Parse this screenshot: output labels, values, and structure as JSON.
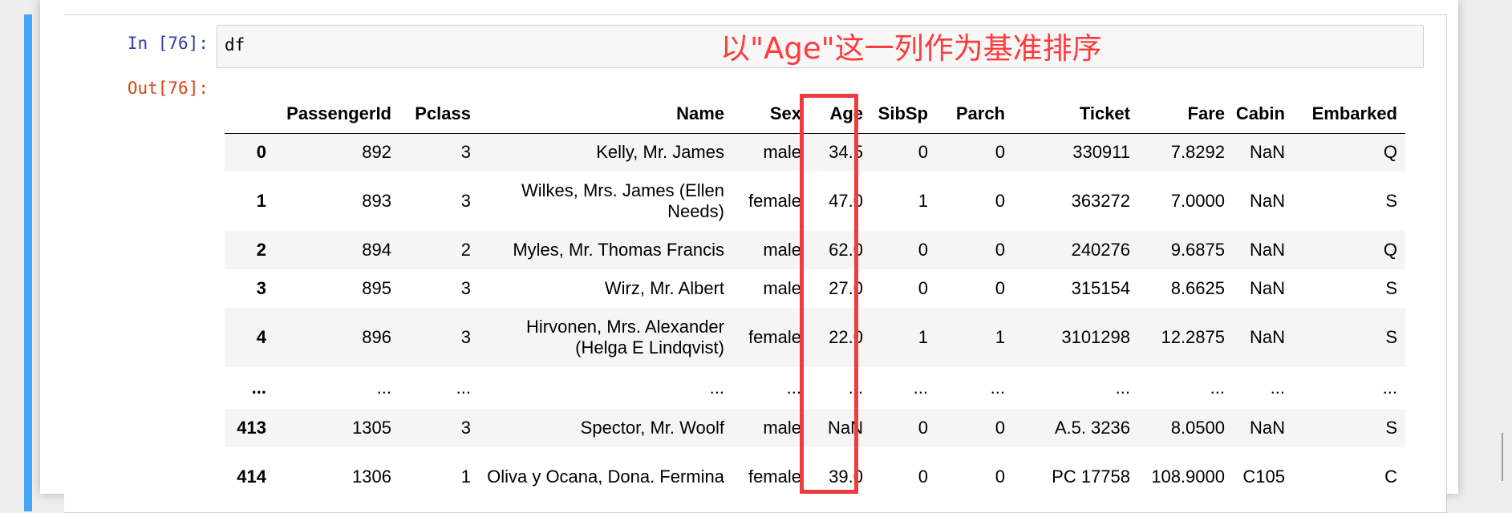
{
  "notebook": {
    "input_prompt": "In  [76]:",
    "input_code": "df",
    "output_prompt": "Out[76]:",
    "annotation": "以\"Age\"这一列作为基准排序"
  },
  "colors": {
    "cell_bar": "#42a5f5",
    "highlight": "#ee3b3b",
    "annotation": "#ff3b3b"
  },
  "table": {
    "columns": [
      "",
      "PassengerId",
      "Pclass",
      "Name",
      "Sex",
      "Age",
      "SibSp",
      "Parch",
      "Ticket",
      "Fare",
      "Cabin",
      "Embarked"
    ],
    "rows": [
      {
        "cells": [
          "0",
          "892",
          "3",
          "Kelly, Mr. James",
          "male",
          "34.5",
          "0",
          "0",
          "330911",
          "7.8292",
          "NaN",
          "Q"
        ]
      },
      {
        "cells": [
          "1",
          "893",
          "3",
          "Wilkes, Mrs. James (Ellen Needs)",
          "female",
          "47.0",
          "1",
          "0",
          "363272",
          "7.0000",
          "NaN",
          "S"
        ]
      },
      {
        "cells": [
          "2",
          "894",
          "2",
          "Myles, Mr. Thomas Francis",
          "male",
          "62.0",
          "0",
          "0",
          "240276",
          "9.6875",
          "NaN",
          "Q"
        ]
      },
      {
        "cells": [
          "3",
          "895",
          "3",
          "Wirz, Mr. Albert",
          "male",
          "27.0",
          "0",
          "0",
          "315154",
          "8.6625",
          "NaN",
          "S"
        ]
      },
      {
        "cells": [
          "4",
          "896",
          "3",
          "Hirvonen, Mrs. Alexander (Helga E Lindqvist)",
          "female",
          "22.0",
          "1",
          "1",
          "3101298",
          "12.2875",
          "NaN",
          "S"
        ]
      },
      {
        "cells": [
          "...",
          "...",
          "...",
          "...",
          "...",
          "...",
          "...",
          "...",
          "...",
          "...",
          "...",
          "..."
        ]
      },
      {
        "cells": [
          "413",
          "1305",
          "3",
          "Spector, Mr. Woolf",
          "male",
          "NaN",
          "0",
          "0",
          "A.5. 3236",
          "8.0500",
          "NaN",
          "S"
        ]
      },
      {
        "cells": [
          "414",
          "1306",
          "1",
          "Oliva y Ocana, Dona. Fermina",
          "female",
          "39.0",
          "0",
          "0",
          "PC 17758",
          "108.9000",
          "C105",
          "C"
        ]
      }
    ]
  }
}
